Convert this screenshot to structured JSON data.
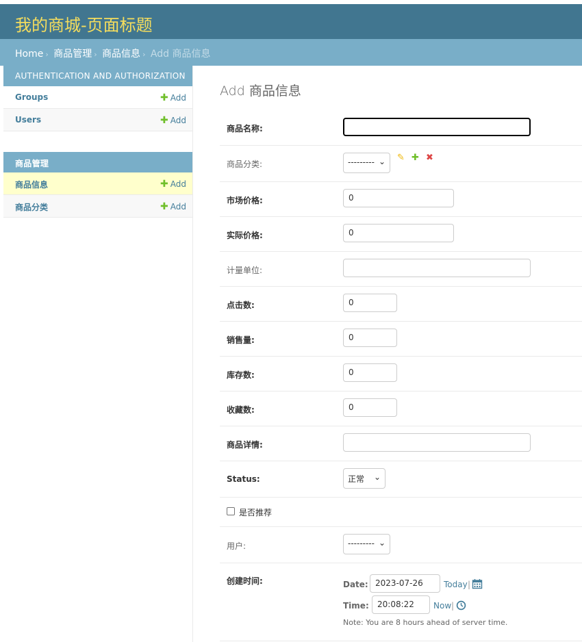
{
  "header": {
    "title": "我的商城-页面标题"
  },
  "breadcrumbs": {
    "home": "Home",
    "app": "商品管理",
    "model": "商品信息",
    "current": "Add 商品信息",
    "separator": "›"
  },
  "sidebar": {
    "modules": [
      {
        "caption": "AUTHENTICATION AND AUTHORIZATION",
        "items": [
          {
            "label": "Groups",
            "add": "Add"
          },
          {
            "label": "Users",
            "add": "Add"
          }
        ]
      },
      {
        "caption": "商品管理",
        "items": [
          {
            "label": "商品信息",
            "add": "Add",
            "current": true
          },
          {
            "label": "商品分类",
            "add": "Add"
          }
        ]
      }
    ]
  },
  "content": {
    "title": "Add 商品信息",
    "fields": {
      "name": {
        "label": "商品名称:",
        "value": ""
      },
      "category": {
        "label": "商品分类:",
        "value": "---------"
      },
      "market_price": {
        "label": "市场价格:",
        "value": "0"
      },
      "real_price": {
        "label": "实际价格:",
        "value": "0"
      },
      "unit": {
        "label": "计量单位:",
        "value": ""
      },
      "clicks": {
        "label": "点击数:",
        "value": "0"
      },
      "sales": {
        "label": "销售量:",
        "value": "0"
      },
      "stock": {
        "label": "库存数:",
        "value": "0"
      },
      "favorites": {
        "label": "收藏数:",
        "value": "0"
      },
      "detail": {
        "label": "商品详情:",
        "value": ""
      },
      "status": {
        "label": "Status:",
        "value": "正常"
      },
      "recommend": {
        "label": "是否推荐",
        "checked": false
      },
      "user": {
        "label": "用户:",
        "value": "---------"
      },
      "created": {
        "label": "创建时间:",
        "date_label": "Date:",
        "date_value": "2023-07-26",
        "today": "Today",
        "time_label": "Time:",
        "time_value": "20:08:22",
        "now": "Now",
        "sep": "|",
        "note": "Note: You are 8 hours ahead of server time."
      }
    }
  },
  "icons": {
    "add": "plus-icon",
    "edit": "pencil-icon",
    "delete": "x-icon",
    "calendar": "calendar-icon",
    "clock": "clock-icon"
  },
  "colors": {
    "header_bg": "#417690",
    "brand": "#f5dd5d",
    "breadcrumb_bg": "#79aec8",
    "link": "#447e9b",
    "add_green": "#70bf2b",
    "current_row": "#ffffcc"
  }
}
